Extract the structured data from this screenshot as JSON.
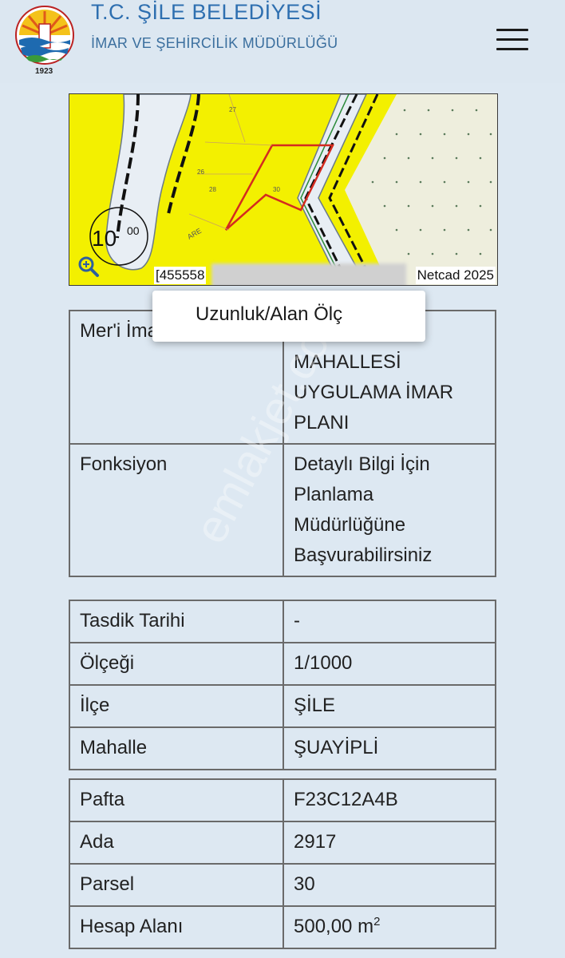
{
  "header": {
    "title": "T.C. ŞİLE BELEDİYESİ",
    "subtitle": "İMAR VE ŞEHİRCİLİK MÜDÜRLÜĞÜ",
    "logo_text": "ŞİLE BELEDİYESİ",
    "logo_year": "1923",
    "menu_icon": "hamburger-icon"
  },
  "map": {
    "label_main": "10",
    "label_sup": "00",
    "coord": "[455558",
    "attribution": "Netcad 2025",
    "parcel_labels": [
      "27",
      "28",
      "30",
      "26",
      "ARE"
    ],
    "zoom_icon": "zoom-in-icon"
  },
  "context_menu": {
    "item": "Uzunluk/Alan Ölç"
  },
  "table1": {
    "rows": [
      {
        "key": "Mer'i İmar",
        "value": "MAHALLESİ UYGULAMA İMAR PLANI"
      },
      {
        "key": "Fonksiyon",
        "value": "Detaylı Bilgi İçin Planlama Müdürlüğüne Başvurabilirsiniz"
      }
    ]
  },
  "table2": {
    "rows": [
      {
        "key": "Tasdik Tarihi",
        "value": "-"
      },
      {
        "key": "Ölçeği",
        "value": "1/1000"
      },
      {
        "key": "İlçe",
        "value": "ŞİLE"
      },
      {
        "key": "Mahalle",
        "value": "ŞUAYİPLİ"
      }
    ]
  },
  "table3": {
    "rows": [
      {
        "key": "Pafta",
        "value": "F23C12A4B"
      },
      {
        "key": "Ada",
        "value": "2917"
      },
      {
        "key": "Parsel",
        "value": "30"
      },
      {
        "key": "Hesap Alanı",
        "value": "500,00 m",
        "unit_sup": "2"
      }
    ]
  },
  "watermark": "emlakjet.com",
  "colors": {
    "background": "#dde8f2",
    "title_blue": "#2e6fb0",
    "map_yellow": "#f3f000",
    "parcel_red": "#d42b1f"
  }
}
